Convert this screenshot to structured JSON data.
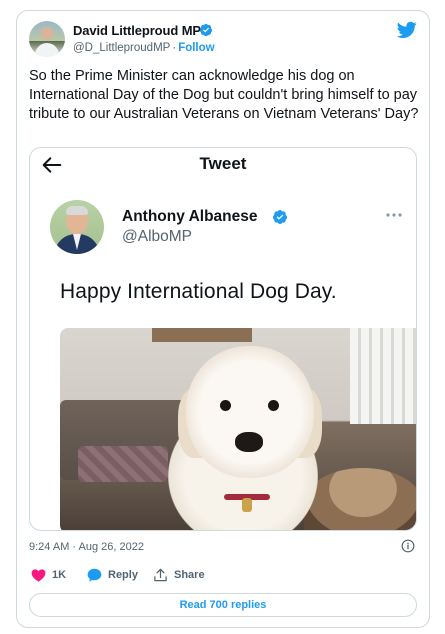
{
  "author": {
    "name": "David Littleproud MP",
    "handle": "@D_LittleproudMP",
    "separator": "·",
    "follow_label": "Follow"
  },
  "tweet": {
    "text": "So the Prime Minister can acknowledge his dog on International Day of the Dog but couldn't bring himself to pay tribute to our Australian Veterans on Vietnam Veterans' Day?",
    "timestamp": "9:24 AM · Aug 26, 2022"
  },
  "quoted": {
    "header_title": "Tweet",
    "author_name": "Anthony Albanese",
    "author_handle": "@AlboMP",
    "text": "Happy International Dog Day."
  },
  "actions": {
    "like_count": "1K",
    "reply_label": "Reply",
    "share_label": "Share",
    "read_replies_label": "Read 700 replies"
  },
  "colors": {
    "brand_blue": "#1d9bf0",
    "like_pink": "#f91880",
    "text_primary": "#0f1419",
    "text_secondary": "#536471",
    "border": "#cfd9de"
  },
  "icons": {
    "twitter_logo": "twitter-bird-icon",
    "verified": "verified-badge-icon",
    "back": "back-arrow-icon",
    "more": "more-options-icon",
    "info": "info-icon",
    "like": "heart-icon",
    "reply": "reply-bubble-icon",
    "share": "share-icon"
  }
}
